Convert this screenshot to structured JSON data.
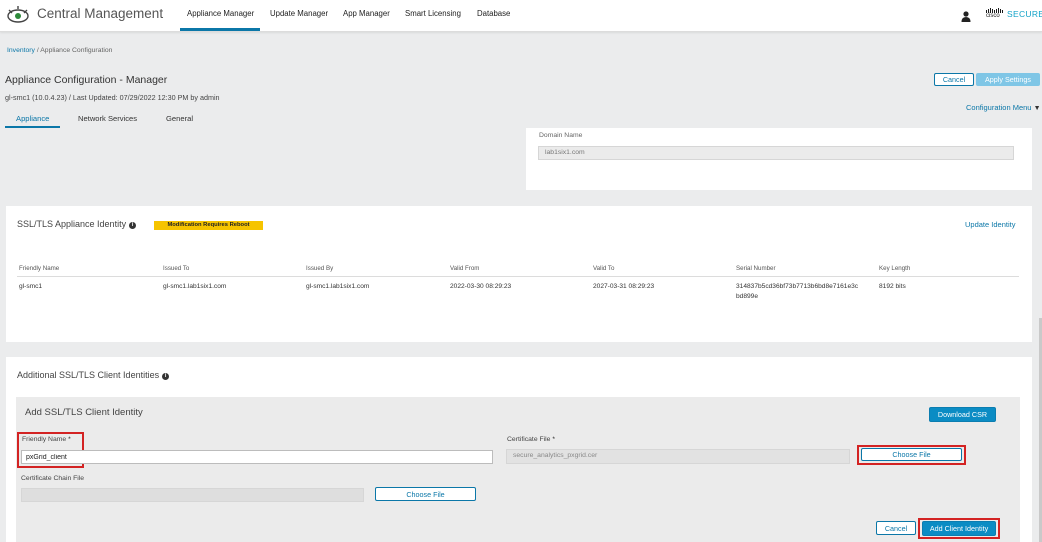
{
  "header": {
    "app_title": "Central Management",
    "nav": [
      "Appliance Manager",
      "Update Manager",
      "App Manager",
      "Smart Licensing",
      "Database"
    ],
    "active_nav": "Appliance Manager",
    "brand_small": "cisco",
    "brand": "SECURE",
    "icons": [
      "logo-icon",
      "user-icon"
    ]
  },
  "breadcrumb": {
    "root": "Inventory",
    "sep": "/",
    "current": "Appliance Configuration"
  },
  "page": {
    "title": "Appliance Configuration - Manager",
    "subtitle": "gl-smc1 (10.0.4.23) / Last Updated: 07/29/2022 12:30 PM by admin",
    "cancel_label": "Cancel",
    "apply_label": "Apply Settings",
    "config_menu_label": "Configuration Menu",
    "tabs": [
      "Appliance",
      "Network Services",
      "General"
    ],
    "active_tab": "Appliance"
  },
  "domain": {
    "label": "Domain Name",
    "value": "lab1six1.com"
  },
  "ssl_identity": {
    "title": "SSL/TLS Appliance Identity",
    "badge": "Modification Requires Reboot",
    "update_label": "Update Identity",
    "columns": [
      "Friendly Name",
      "Issued To",
      "Issued By",
      "Valid From",
      "Valid To",
      "Serial Number",
      "Key Length"
    ],
    "row": {
      "friendly_name": "gl-smc1",
      "issued_to": "gl-smc1.lab1six1.com",
      "issued_by": "gl-smc1.lab1six1.com",
      "valid_from": "2022-03-30 08:29:23",
      "valid_to": "2027-03-31 08:29:23",
      "serial_line1": "314837b5cd36bf73b7713b6bd8e7161e3c",
      "serial_line2": "bd899e",
      "key_length": "8192 bits"
    }
  },
  "client_identities": {
    "title": "Additional SSL/TLS Client Identities",
    "add_title": "Add SSL/TLS Client Identity",
    "download_csr_label": "Download CSR",
    "friendly_name_label": "Friendly Name",
    "friendly_name_value": "pxGrid_client",
    "required_mark": "*",
    "certificate_file_label": "Certificate File",
    "certificate_file_value": "secure_analytics_pxgrid.cer",
    "choose_file_label": "Choose File",
    "chain_file_label": "Certificate Chain File",
    "cancel_label": "Cancel",
    "add_label": "Add Client Identity"
  },
  "colors": {
    "accent": "#0b77a8",
    "highlight": "#d32323",
    "badge": "#f6c400",
    "brand": "#13a3c8"
  }
}
